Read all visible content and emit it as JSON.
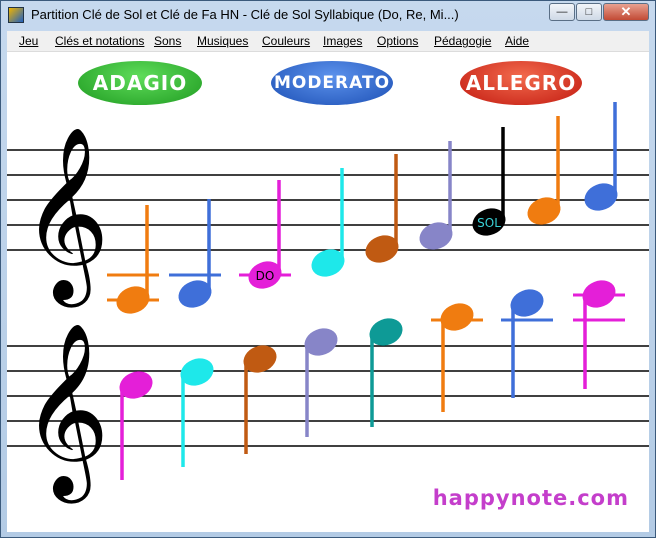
{
  "window": {
    "title": "Partition Clé de Sol et Clé de Fa HN - Clé de Sol Syllabique (Do, Re, Mi...)",
    "minimize_glyph": "—",
    "maximize_glyph": "□",
    "close_glyph": "✕"
  },
  "menu": [
    "Jeu",
    "Clés et notations",
    "Sons",
    "Musiques",
    "Couleurs",
    "Images",
    "Options",
    "Pédagogie",
    "Aide"
  ],
  "tempo": {
    "adagio": "ADAGIO",
    "moderato": "MODERATO",
    "allegro": "ALLEGRO",
    "colors": {
      "adagio": "#2db52d",
      "moderato": "#2f6ad0",
      "allegro": "#e02a1c"
    }
  },
  "staff1_notes": [
    {
      "color": "#f07c10"
    },
    {
      "color": "#3f6fd9"
    },
    {
      "color": "#e41fd8",
      "label": "DO"
    },
    {
      "color": "#1ee8ea"
    },
    {
      "color": "#c05a12"
    },
    {
      "color": "#8785c8"
    },
    {
      "color": "#000000",
      "label": "SOL"
    },
    {
      "color": "#f07c10"
    },
    {
      "color": "#3f6fd9"
    }
  ],
  "staff2_notes": [
    {
      "color": "#e41fd8"
    },
    {
      "color": "#1ee8ea"
    },
    {
      "color": "#c05a12"
    },
    {
      "color": "#8785c8"
    },
    {
      "color": "#0e9a96"
    },
    {
      "color": "#f07c10"
    },
    {
      "color": "#3f6fd9"
    },
    {
      "color": "#e41fd8"
    }
  ],
  "footer": {
    "brand": "happynote.com"
  },
  "clef": "𝄞"
}
